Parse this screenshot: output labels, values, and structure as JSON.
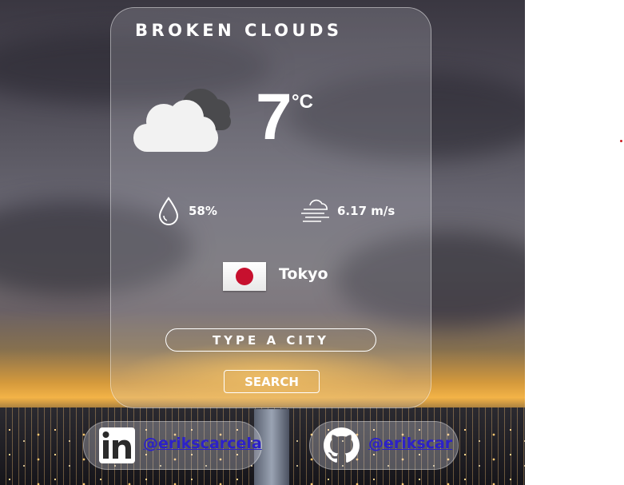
{
  "weather": {
    "description": "BROKEN CLOUDS",
    "icon": "broken-clouds-icon",
    "temperature": "7",
    "unit": "°C",
    "humidity": "58%",
    "wind_speed": "6.17 m/s"
  },
  "location": {
    "city": "Tokyo",
    "flag": "japan-flag"
  },
  "search": {
    "placeholder": "TYPE A CITY",
    "button_label": "SEARCH"
  },
  "social": {
    "linkedin": {
      "icon": "linkedin-icon",
      "handle": "@erikscarcela"
    },
    "github": {
      "icon": "github-icon",
      "handle": "@erikscar"
    }
  },
  "colors": {
    "link": "#2c21c9",
    "text": "#ffffff",
    "flag_red": "#c7102e"
  }
}
